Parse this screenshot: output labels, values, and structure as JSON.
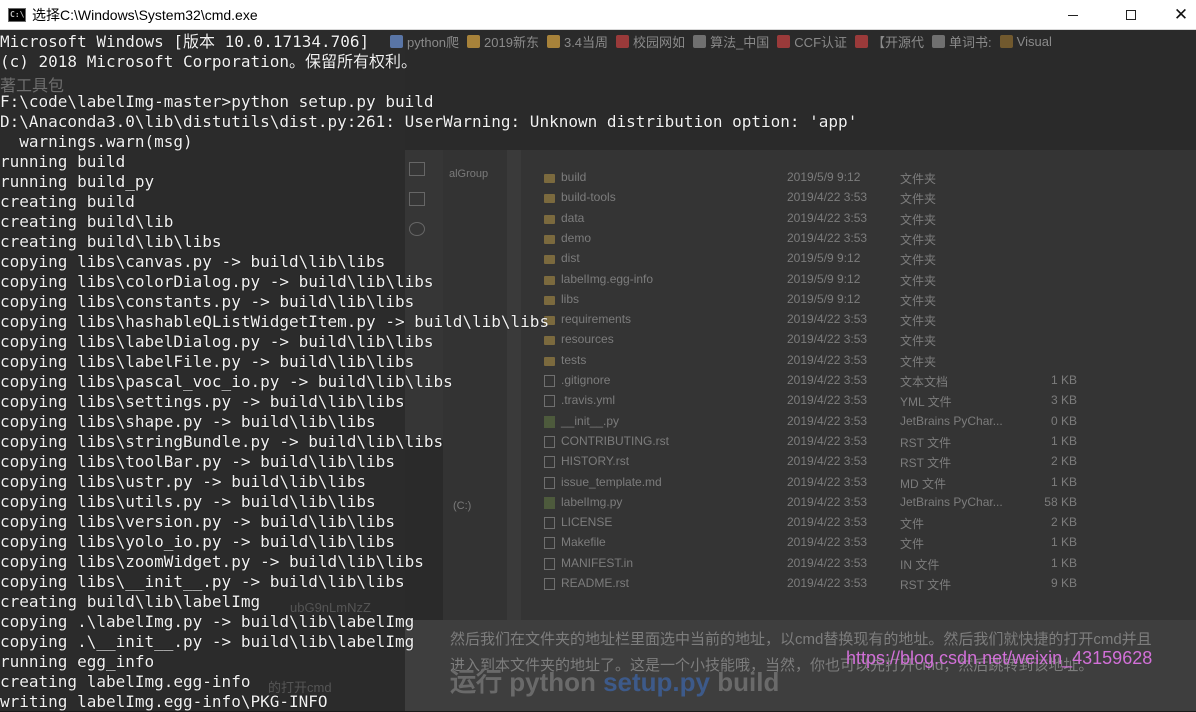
{
  "window": {
    "title": "选择C:\\Windows\\System32\\cmd.exe",
    "icon": "cmd-icon",
    "controls": {
      "minimize": "—",
      "maximize": "□",
      "close": "✕"
    }
  },
  "console": {
    "foreground": "#f2f2f2",
    "lines": [
      "Microsoft Windows [版本 10.0.17134.706]",
      "(c) 2018 Microsoft Corporation。保留所有权利。",
      "",
      "F:\\code\\labelImg-master>python setup.py build",
      "D:\\Anaconda3.0\\lib\\distutils\\dist.py:261: UserWarning: Unknown distribution option: 'app'",
      "  warnings.warn(msg)",
      "running build",
      "running build_py",
      "creating build",
      "creating build\\lib",
      "creating build\\lib\\libs",
      "copying libs\\canvas.py -> build\\lib\\libs",
      "copying libs\\colorDialog.py -> build\\lib\\libs",
      "copying libs\\constants.py -> build\\lib\\libs",
      "copying libs\\hashableQListWidgetItem.py -> build\\lib\\libs",
      "copying libs\\labelDialog.py -> build\\lib\\libs",
      "copying libs\\labelFile.py -> build\\lib\\libs",
      "copying libs\\pascal_voc_io.py -> build\\lib\\libs",
      "copying libs\\settings.py -> build\\lib\\libs",
      "copying libs\\shape.py -> build\\lib\\libs",
      "copying libs\\stringBundle.py -> build\\lib\\libs",
      "copying libs\\toolBar.py -> build\\lib\\libs",
      "copying libs\\ustr.py -> build\\lib\\libs",
      "copying libs\\utils.py -> build\\lib\\libs",
      "copying libs\\version.py -> build\\lib\\libs",
      "copying libs\\yolo_io.py -> build\\lib\\libs",
      "copying libs\\zoomWidget.py -> build\\lib\\libs",
      "copying libs\\__init__.py -> build\\lib\\libs",
      "creating build\\lib\\labelImg",
      "copying .\\labelImg.py -> build\\lib\\labelImg",
      "copying .\\__init__.py -> build\\lib\\labelImg",
      "running egg_info",
      "creating labelImg.egg-info",
      "writing labelImg.egg-info\\PKG-INFO"
    ]
  },
  "background": {
    "bookmarks": [
      {
        "label": "python爬",
        "color": "#6a8fd0"
      },
      {
        "label": "2019新东",
        "color": "#d1a040"
      },
      {
        "label": "3.4当周",
        "color": "#d1a040"
      },
      {
        "label": "校园网如",
        "color": "#c04040"
      },
      {
        "label": "算法_中国",
        "color": "#888888"
      },
      {
        "label": "CCF认证",
        "color": "#c04040"
      },
      {
        "label": "【开源代",
        "color": "#c04040"
      },
      {
        "label": "单词书:",
        "color": "#888888"
      },
      {
        "label": "Visual",
        "color": "#8a6a30"
      }
    ],
    "tools_label": "著工具包",
    "nav_label": "alGroup",
    "drive_label": "(C:)",
    "ghost_text": "ubG9nLmNzZ",
    "ghost_text2": "的打开cmd",
    "files": [
      {
        "name": "build",
        "date": "2019/5/9 9:12",
        "type": "文件夹",
        "size": "",
        "icon": "folder"
      },
      {
        "name": "build-tools",
        "date": "2019/4/22 3:53",
        "type": "文件夹",
        "size": "",
        "icon": "folder"
      },
      {
        "name": "data",
        "date": "2019/4/22 3:53",
        "type": "文件夹",
        "size": "",
        "icon": "folder"
      },
      {
        "name": "demo",
        "date": "2019/4/22 3:53",
        "type": "文件夹",
        "size": "",
        "icon": "folder"
      },
      {
        "name": "dist",
        "date": "2019/5/9 9:12",
        "type": "文件夹",
        "size": "",
        "icon": "folder"
      },
      {
        "name": "labelImg.egg-info",
        "date": "2019/5/9 9:12",
        "type": "文件夹",
        "size": "",
        "icon": "folder"
      },
      {
        "name": "libs",
        "date": "2019/5/9 9:12",
        "type": "文件夹",
        "size": "",
        "icon": "folder"
      },
      {
        "name": "requirements",
        "date": "2019/4/22 3:53",
        "type": "文件夹",
        "size": "",
        "icon": "folder"
      },
      {
        "name": "resources",
        "date": "2019/4/22 3:53",
        "type": "文件夹",
        "size": "",
        "icon": "folder"
      },
      {
        "name": "tests",
        "date": "2019/4/22 3:53",
        "type": "文件夹",
        "size": "",
        "icon": "folder"
      },
      {
        "name": ".gitignore",
        "date": "2019/4/22 3:53",
        "type": "文本文档",
        "size": "1 KB",
        "icon": "doc"
      },
      {
        "name": ".travis.yml",
        "date": "2019/4/22 3:53",
        "type": "YML 文件",
        "size": "3 KB",
        "icon": "doc"
      },
      {
        "name": "__init__.py",
        "date": "2019/4/22 3:53",
        "type": "JetBrains PyChar...",
        "size": "0 KB",
        "icon": "py"
      },
      {
        "name": "CONTRIBUTING.rst",
        "date": "2019/4/22 3:53",
        "type": "RST 文件",
        "size": "1 KB",
        "icon": "doc"
      },
      {
        "name": "HISTORY.rst",
        "date": "2019/4/22 3:53",
        "type": "RST 文件",
        "size": "2 KB",
        "icon": "doc"
      },
      {
        "name": "issue_template.md",
        "date": "2019/4/22 3:53",
        "type": "MD 文件",
        "size": "1 KB",
        "icon": "doc"
      },
      {
        "name": "labelImg.py",
        "date": "2019/4/22 3:53",
        "type": "JetBrains PyChar...",
        "size": "58 KB",
        "icon": "py"
      },
      {
        "name": "LICENSE",
        "date": "2019/4/22 3:53",
        "type": "文件",
        "size": "2 KB",
        "icon": "doc"
      },
      {
        "name": "Makefile",
        "date": "2019/4/22 3:53",
        "type": "文件",
        "size": "1 KB",
        "icon": "doc"
      },
      {
        "name": "MANIFEST.in",
        "date": "2019/4/22 3:53",
        "type": "IN 文件",
        "size": "1 KB",
        "icon": "doc"
      },
      {
        "name": "README.rst",
        "date": "2019/4/22 3:53",
        "type": "RST 文件",
        "size": "9 KB",
        "icon": "doc"
      }
    ],
    "blog_line1": "然后我们在文件夹的地址栏里面选中当前的地址，以cmd替换现有的地址。然后我们就快捷的打开cmd并且",
    "blog_line2": "进入到本文件夹的地址了。这是一个小技能哦，当然，你也可以先打开cmd，然后跳转到该地址。",
    "blog_heading_pre": "运行 python ",
    "blog_heading_link": "setup.py",
    "blog_heading_post": " build",
    "watermark": "https://blog.csdn.net/weixin_43159628"
  }
}
